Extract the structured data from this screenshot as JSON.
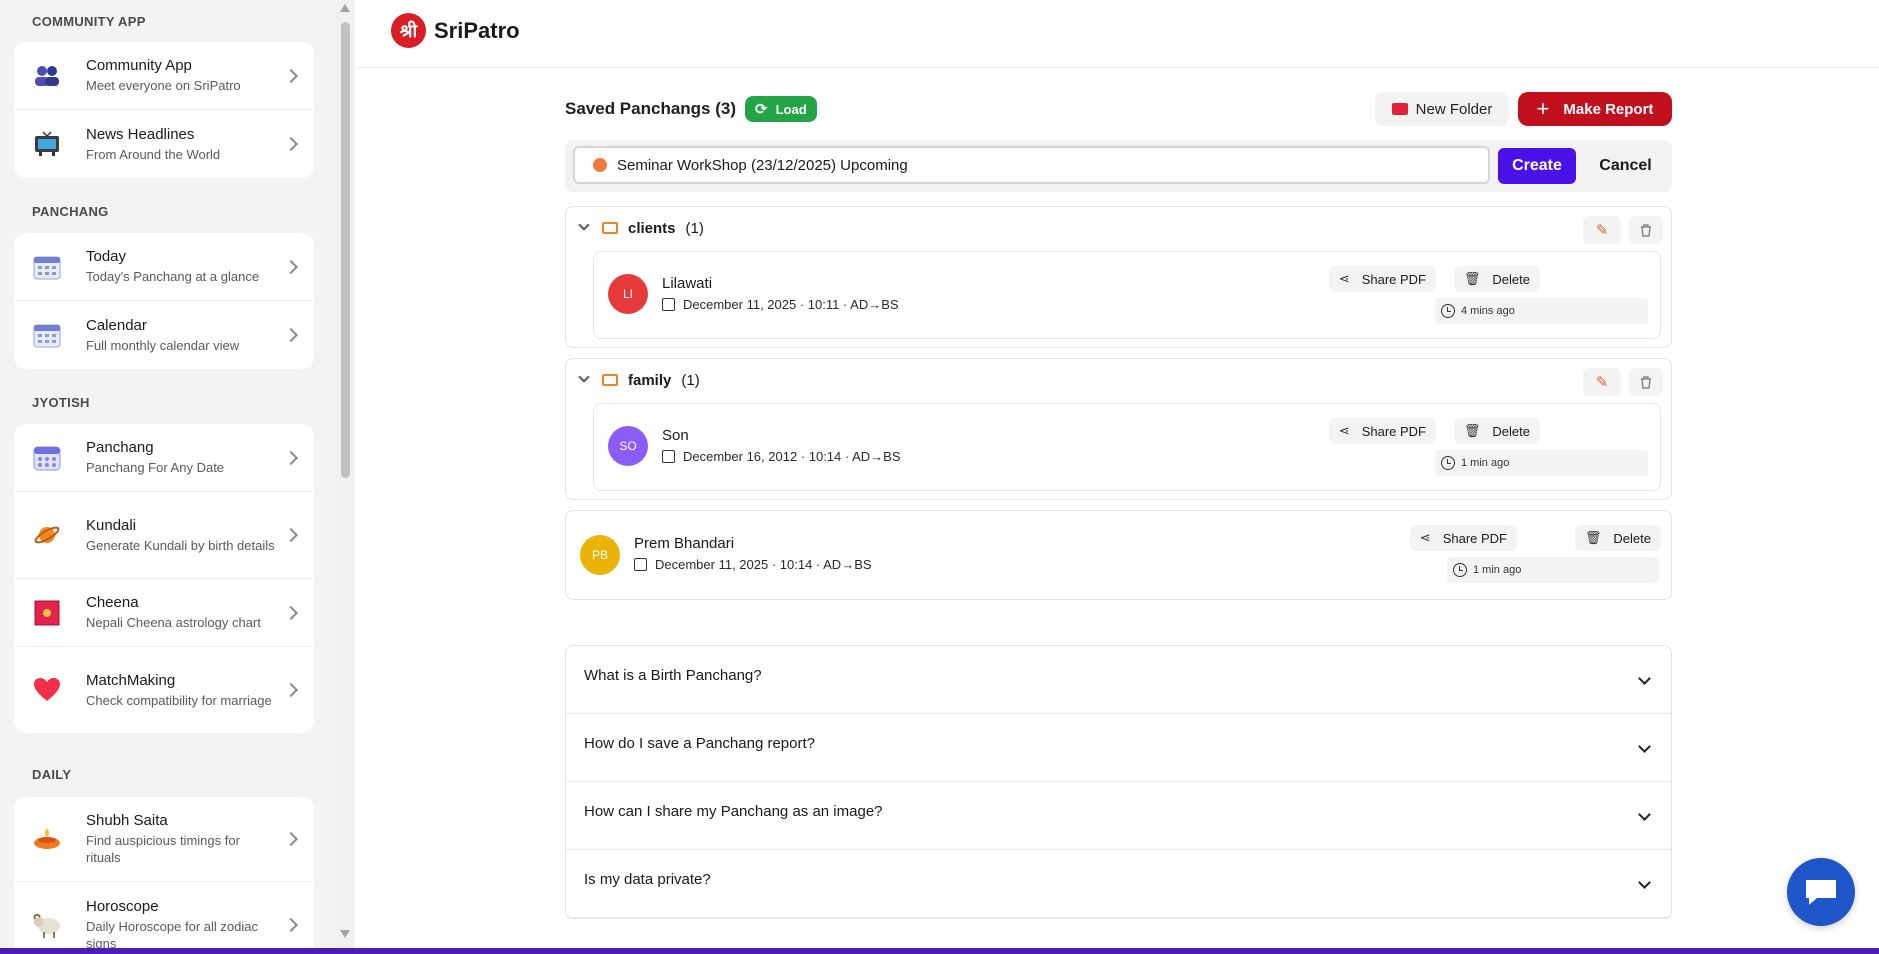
{
  "sidebar": {
    "sections": [
      {
        "label": "COMMUNITY APP",
        "items": [
          {
            "title": "Community App",
            "sub": "Meet everyone on SriPatro",
            "icon": "people-icon"
          },
          {
            "title": "News Headlines",
            "sub": "From Around the World",
            "icon": "tv-icon"
          }
        ]
      },
      {
        "label": "PANCHANG",
        "items": [
          {
            "title": "Today",
            "sub": "Today's Panchang at a glance",
            "icon": "calendar-icon"
          },
          {
            "title": "Calendar",
            "sub": "Full monthly calendar view",
            "icon": "calendar-grid-icon"
          }
        ]
      },
      {
        "label": "JYOTISH",
        "items": [
          {
            "title": "Panchang",
            "sub": "Panchang For Any Date",
            "icon": "calendar-grid-icon"
          },
          {
            "title": "Kundali",
            "sub": "Generate Kundali by birth details",
            "icon": "planet-icon"
          },
          {
            "title": "Cheena",
            "sub": "Nepali Cheena astrology chart",
            "icon": "cheena-icon"
          },
          {
            "title": "MatchMaking",
            "sub": "Check compatibility for marriage",
            "icon": "heart-icon"
          }
        ]
      },
      {
        "label": "DAILY",
        "items": [
          {
            "title": "Shubh Saita",
            "sub": "Find auspicious timings for rituals",
            "icon": "diya-icon"
          },
          {
            "title": "Horoscope",
            "sub": "Daily Horoscope for all zodiac signs",
            "icon": "ram-icon"
          }
        ]
      }
    ]
  },
  "header": {
    "logo_mark": "श्री",
    "logo_text": "SriPatro"
  },
  "toolbar": {
    "title": "Saved Panchangs (3)",
    "load_label": "Load",
    "new_folder_label": "New Folder",
    "make_report_label": "Make Report"
  },
  "create_folder": {
    "value": "Seminar WorkShop (23/12/2025) Upcoming",
    "create_label": "Create",
    "cancel_label": "Cancel"
  },
  "folders": [
    {
      "name": "clients",
      "count": "(1)",
      "entries": [
        {
          "initials": "LI",
          "avatar_color": "#e53a3a",
          "name": "Lilawati",
          "meta": "December 11, 2025 · 10:11 · AD→BS",
          "share": "Share PDF",
          "delete": "Delete",
          "ago": "4 mins ago"
        }
      ]
    },
    {
      "name": "family",
      "count": "(1)",
      "entries": [
        {
          "initials": "SO",
          "avatar_color": "#8b5cf6",
          "name": "Son",
          "meta": "December 16, 2012 · 10:14 · AD→BS",
          "share": "Share PDF",
          "delete": "Delete",
          "ago": "1 min ago"
        }
      ]
    }
  ],
  "standalone": {
    "initials": "PB",
    "avatar_color": "#eab308",
    "name": "Prem Bhandari",
    "meta": "December 11, 2025 · 10:14 · AD→BS",
    "share": "Share PDF",
    "delete": "Delete",
    "ago": "1 min ago"
  },
  "faq": [
    "What is a Birth Panchang?",
    "How do I save a Panchang report?",
    "How can I share my Panchang as an image?",
    "Is my data private?"
  ],
  "colors": {
    "brand_red": "#c0101e",
    "accent_purple": "#4a12e8",
    "load_green": "#22a447",
    "chat_blue": "#1e55c9"
  }
}
